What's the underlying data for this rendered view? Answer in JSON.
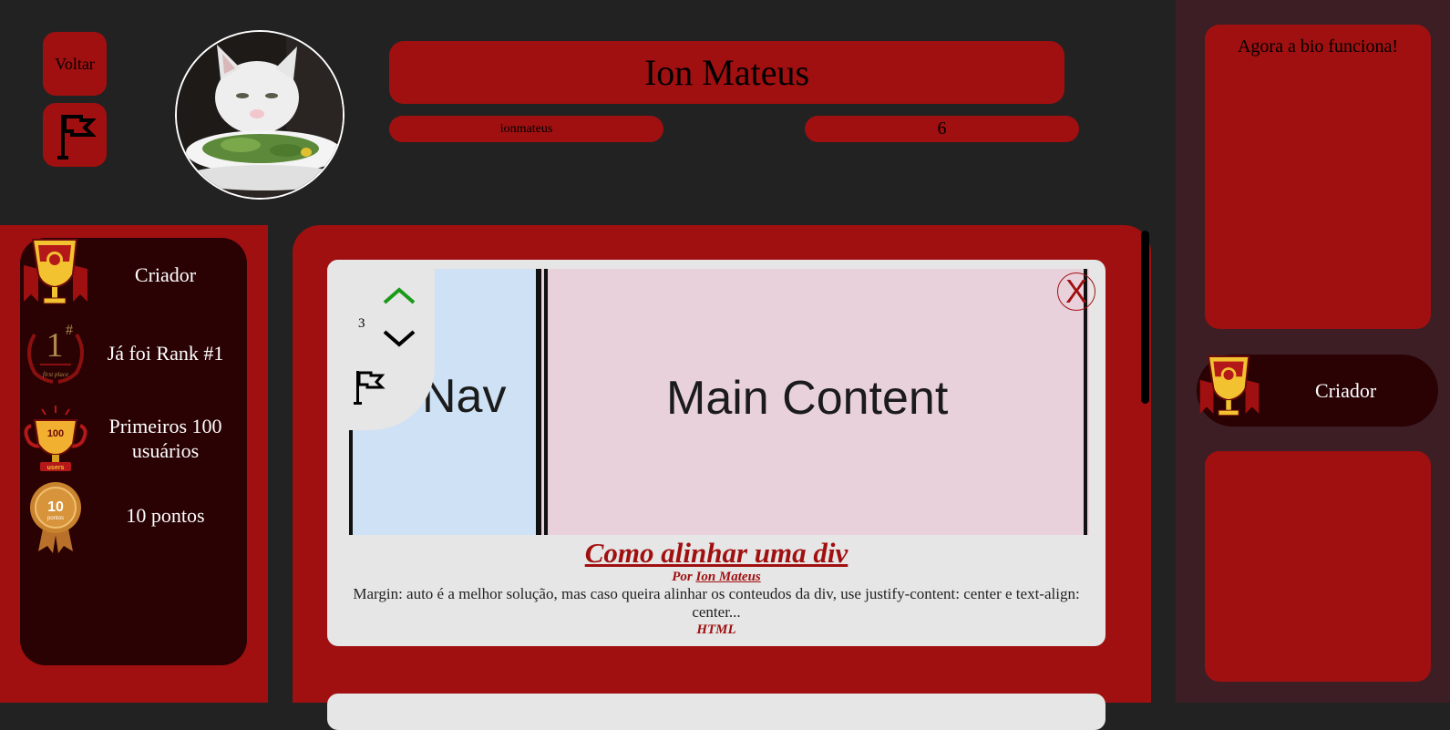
{
  "header": {
    "back_label": "Voltar",
    "display_name": "Ion Mateus",
    "username": "ionmateus",
    "points": "6"
  },
  "achievements": [
    {
      "label": "Criador",
      "icon": "trophy-icon"
    },
    {
      "label": "Já foi Rank #1",
      "icon": "rank-one-laurel-icon"
    },
    {
      "label": "Primeiros 100 usuários",
      "icon": "first-100-users-trophy-icon"
    },
    {
      "label": "10 pontos",
      "icon": "ten-points-medal-icon"
    }
  ],
  "achievement_icon_text": {
    "rank": "1",
    "rank_suffix": "#",
    "rank_caption": "first place",
    "users_number": "100",
    "users_caption": "users",
    "medal_number": "10",
    "medal_caption": "pontos"
  },
  "post": {
    "votes": "3",
    "image_nav_text": "Nav",
    "image_main_text": "Main Content",
    "close_label": "X",
    "title": "Como alinhar uma div",
    "author_prefix": "Por",
    "author_name": "Ion Mateus",
    "excerpt": "Margin: auto é a melhor solução, mas caso queira alinhar os conteudos da div, use justify-content: center e text-align: center...",
    "tag": "HTML"
  },
  "sidebar": {
    "bio": "Agora a bio funciona!",
    "featured_badge": "Criador"
  },
  "colors": {
    "background": "#222222",
    "accent_red": "#a01010",
    "dark_card": "#2a0204",
    "sidebar_bg": "#3c1e24",
    "post_card": "#e6e6e6",
    "upvote_green": "#1a9a1a"
  }
}
